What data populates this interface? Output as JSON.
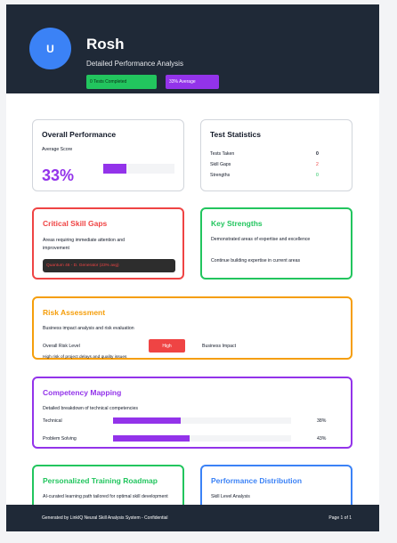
{
  "header": {
    "avatar_initial": "U",
    "name": "Rosh",
    "subtitle": "Detailed Performance Analysis",
    "badges": [
      "0 Tests Completed",
      "33% Average"
    ]
  },
  "overall": {
    "title": "Overall Performance",
    "label": "Average Score",
    "score": "33%",
    "score_fraction": 0.33
  },
  "stats": {
    "title": "Test Statistics",
    "rows": [
      {
        "label": "Tests Taken",
        "value": "0",
        "color": "#111827"
      },
      {
        "label": "Skill Gaps",
        "value": "2",
        "color": "#ef4444"
      },
      {
        "label": "Strengths",
        "value": "0",
        "color": "#22c55e"
      }
    ]
  },
  "gaps": {
    "title": "Critical Skill Gaps",
    "description": "Areas requiring immediate attention and improvement",
    "item": "Quantum 46 - D. Generator (23% avg)"
  },
  "strengths": {
    "title": "Key Strengths",
    "description": "Demonstrated areas of expertise and excellence",
    "note": "Continue building expertise in current areas"
  },
  "risk": {
    "title": "Risk Assessment",
    "description": "Business impact analysis and risk evaluation",
    "overall_label": "Overall Risk Level",
    "level": "High",
    "impact_label": "Business Impact",
    "note": "High risk of project delays and quality issues"
  },
  "competency": {
    "title": "Competency Mapping",
    "description": "Detailed breakdown of technical competencies",
    "items": [
      {
        "label": "Technical",
        "value": "38%",
        "fraction": 0.38
      },
      {
        "label": "Problem Solving",
        "value": "43%",
        "fraction": 0.43
      }
    ]
  },
  "training": {
    "title": "Personalized Training Roadmap",
    "description": "AI-curated learning path tailored for optimal skill development"
  },
  "distribution": {
    "title": "Performance Distribution",
    "description": "Skill Level Analysis"
  },
  "footer": {
    "left": "Generated by LinkIQ Neural Skill Analysis System - Confidential",
    "right": "Page 1 of 1"
  },
  "colors": {
    "accent_purple": "#9333ea",
    "danger": "#ef4444",
    "success": "#22c55e",
    "warning": "#f59e0b",
    "info": "#3b82f6",
    "header_bg": "#1f2937"
  }
}
